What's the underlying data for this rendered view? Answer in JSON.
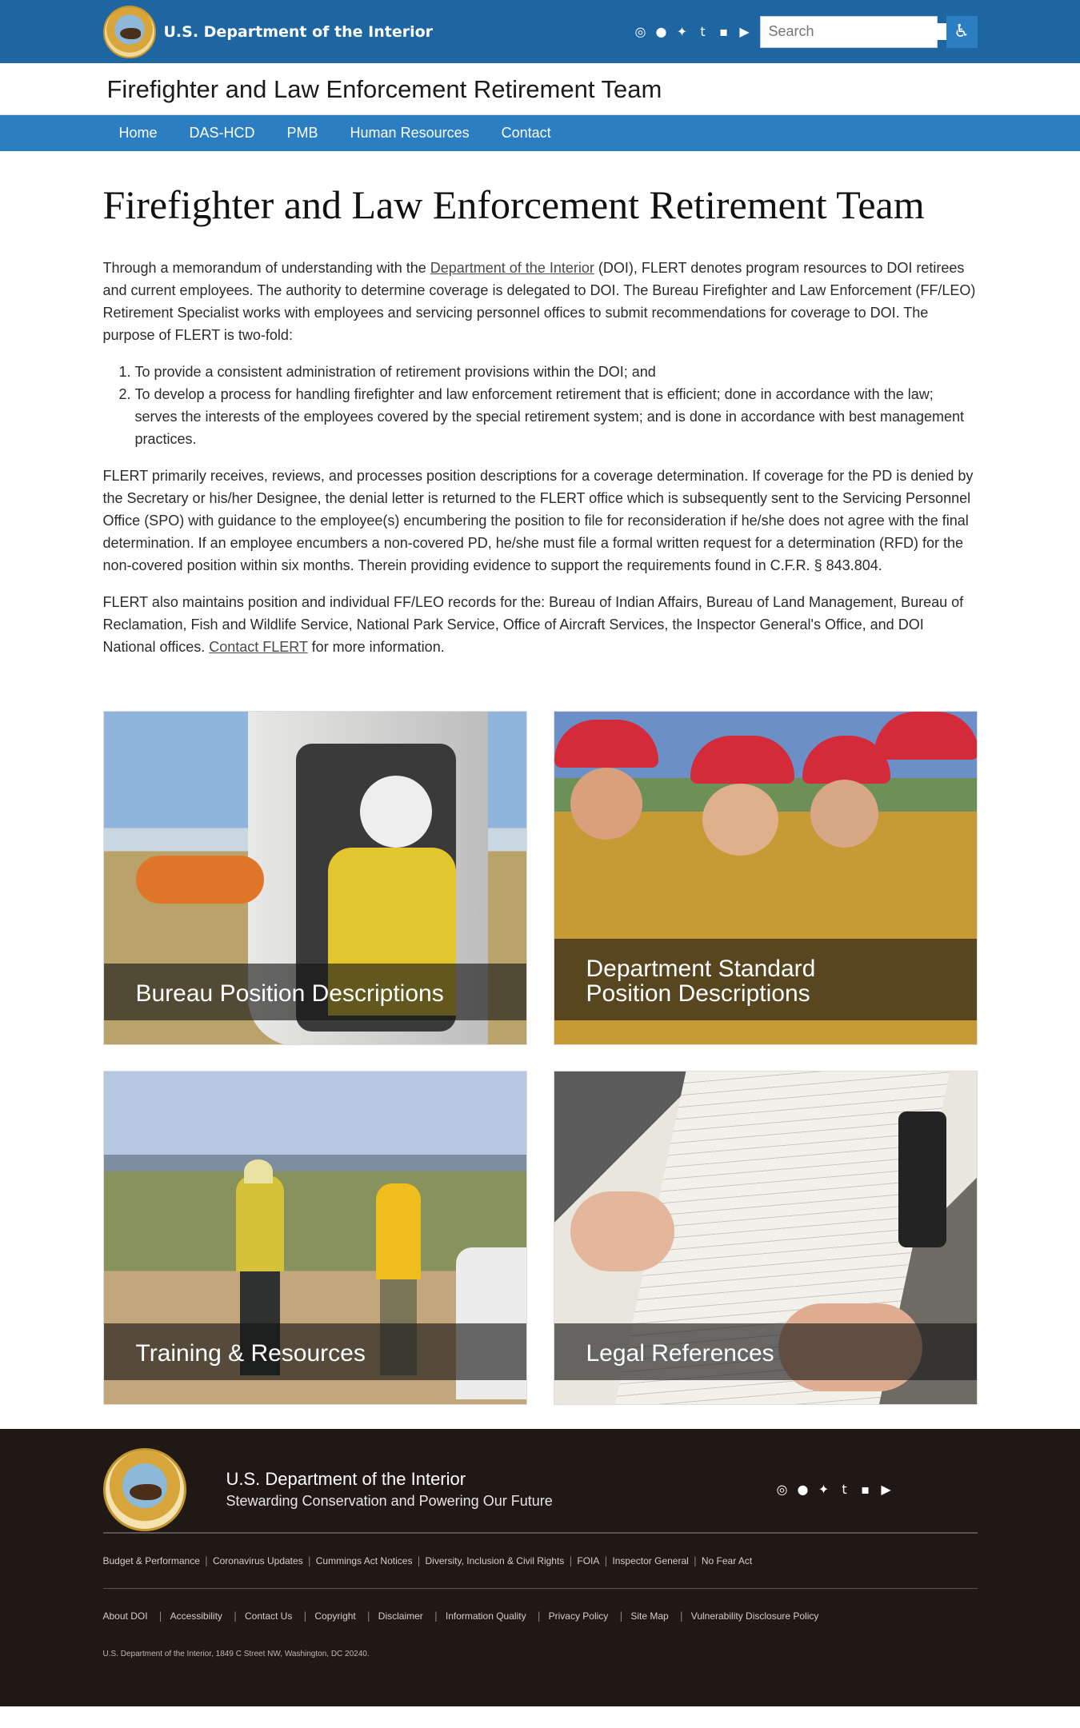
{
  "header": {
    "agency_name": "U.S. Department of the Interior",
    "social_icons": [
      "instagram-icon",
      "facebook-icon",
      "twitter-icon",
      "tumblr-icon",
      "flickr-icon",
      "youtube-icon"
    ],
    "search_placeholder": "Search",
    "site_name": "Firefighter and Law Enforcement Retirement Team"
  },
  "nav": {
    "items": [
      "Home",
      "DAS-HCD",
      "PMB",
      "Human Resources",
      "Contact"
    ]
  },
  "main": {
    "title": "Firefighter and Law Enforcement Retirement Team",
    "p1_before": "Through a memorandum of understanding with the ",
    "p1_link": "Department of the Interior",
    "p1_after": " (DOI), FLERT denotes program resources to DOI retirees and current employees. The authority to determine coverage is delegated to DOI. The Bureau Firefighter and Law Enforcement (FF/LEO) Retirement Specialist works with employees and servicing personnel offices to submit recommendations for coverage to DOI. The purpose of FLERT is two-fold:",
    "list": [
      "To provide a consistent administration of retirement provisions within the DOI; and",
      "To develop a process for handling firefighter and law enforcement retirement that is efficient; done in accordance with the law; serves the interests of the employees covered by the special retirement system; and is done in accordance with best management practices."
    ],
    "p2": "FLERT primarily receives, reviews, and processes position descriptions for a coverage determination.  If coverage for the PD is denied by the Secretary or his/her Designee, the denial letter is returned to the FLERT office which is subsequently sent to the Servicing Personnel Office (SPO) with guidance to the employee(s) encumbering the position to file for reconsideration if he/she does not agree with the final determination.  If an employee encumbers a non-covered PD, he/she must file a formal written request for a determination (RFD) for the non-covered position within six months.  Therein providing evidence to support the requirements found in C.F.R. § 843.804.",
    "p3_before": "FLERT also maintains position and individual FF/LEO records for the: Bureau of Indian Affairs, Bureau of Land Management, Bureau of Reclamation,  Fish and Wildlife Service, National Park Service, Office of Aircraft Services, the Inspector General's Office, and DOI National offices. ",
    "p3_link": "Contact FLERT",
    "p3_after": " for more information."
  },
  "cards": [
    {
      "label": "Bureau Position Descriptions"
    },
    {
      "label_line1": "Department Standard",
      "label_line2": "Position Descriptions"
    },
    {
      "label": "Training & Resources"
    },
    {
      "label": "Legal References"
    }
  ],
  "footer": {
    "name": "U.S. Department of the Interior",
    "tagline": "Stewarding Conservation and Powering Our Future",
    "links1": [
      "Budget & Performance",
      "Coronavirus Updates",
      "Cummings Act Notices",
      "Diversity, Inclusion & Civil Rights",
      "FOIA",
      "Inspector General",
      "No Fear Act"
    ],
    "links2": [
      "About DOI",
      "Accessibility",
      "Contact Us",
      "Copyright",
      "Disclaimer",
      "Information Quality",
      "Privacy Policy",
      "Site Map",
      "Vulnerability Disclosure Policy"
    ],
    "address": "U.S. Department of the Interior, 1849 C Street NW, Washington, DC 20240."
  }
}
